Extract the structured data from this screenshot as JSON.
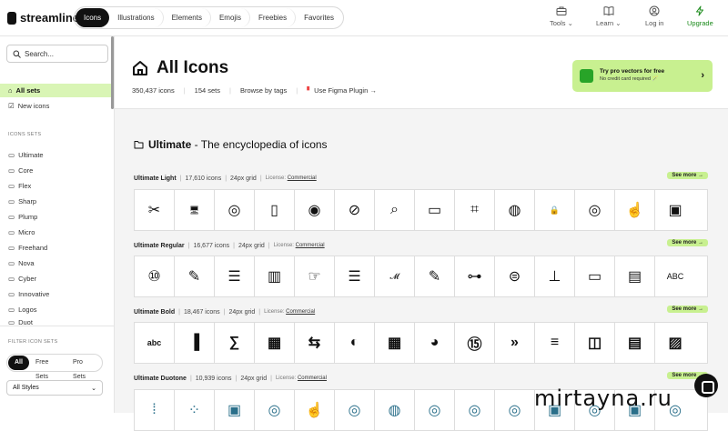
{
  "brand": {
    "name": "streamline"
  },
  "tabs": [
    "Icons",
    "Illustrations",
    "Elements",
    "Emojis",
    "Freebies",
    "Favorites"
  ],
  "nav_right": [
    {
      "label": "Tools",
      "icon": "toolbox-icon",
      "chevron": true
    },
    {
      "label": "Learn",
      "icon": "book-icon",
      "chevron": true
    },
    {
      "label": "Log in",
      "icon": "user-icon",
      "chevron": false
    },
    {
      "label": "Upgrade",
      "icon": "bolt-icon",
      "chevron": false
    }
  ],
  "search": {
    "placeholder": "Search..."
  },
  "sidebar": {
    "top_items": [
      {
        "label": "All sets",
        "active": true
      },
      {
        "label": "New icons",
        "active": false
      }
    ],
    "sets_title": "ICONS SETS",
    "sets": [
      "Ultimate",
      "Core",
      "Flex",
      "Sharp",
      "Plump",
      "Micro",
      "Freehand",
      "Nova",
      "Cyber",
      "Innovative",
      "Logos",
      "Duot"
    ],
    "filter_title": "FILTER ICON SETS",
    "filters": [
      "All",
      "Free Sets",
      "Pro Sets"
    ],
    "styles_select": "All Styles"
  },
  "header": {
    "title": "All Icons",
    "meta": {
      "icons": "350,437 icons",
      "sets": "154 sets",
      "browse": "Browse by tags",
      "figma": "Use Figma Plugin →"
    }
  },
  "promo": {
    "title": "Try pro vectors for free",
    "subtitle": "No credit card required 🪄"
  },
  "section": {
    "name": "Ultimate",
    "tagline": " - The encyclopedia of icons"
  },
  "icon_sets": [
    {
      "name": "Ultimate Light",
      "count": "17,610 icons",
      "grid": "24px grid",
      "license_label": "License:",
      "license": "Commercial",
      "see_more": "See more →",
      "style": "light"
    },
    {
      "name": "Ultimate Regular",
      "count": "16,677 icons",
      "grid": "24px grid",
      "license_label": "License:",
      "license": "Commercial",
      "see_more": "See more →",
      "style": "regular"
    },
    {
      "name": "Ultimate Bold",
      "count": "18,467 icons",
      "grid": "24px grid",
      "license_label": "License:",
      "license": "Commercial",
      "see_more": "See more →",
      "style": "bold"
    },
    {
      "name": "Ultimate Duotone",
      "count": "10,939 icons",
      "grid": "24px grid",
      "license_label": "License:",
      "license": "Commercial",
      "see_more": "See more →",
      "style": "duotone"
    }
  ],
  "watermark": "mirtayna.ru",
  "colors": {
    "accent": "#c8f090",
    "active_bg": "#d9f5b5",
    "upgrade": "#1a8a1a",
    "dark": "#111111"
  }
}
